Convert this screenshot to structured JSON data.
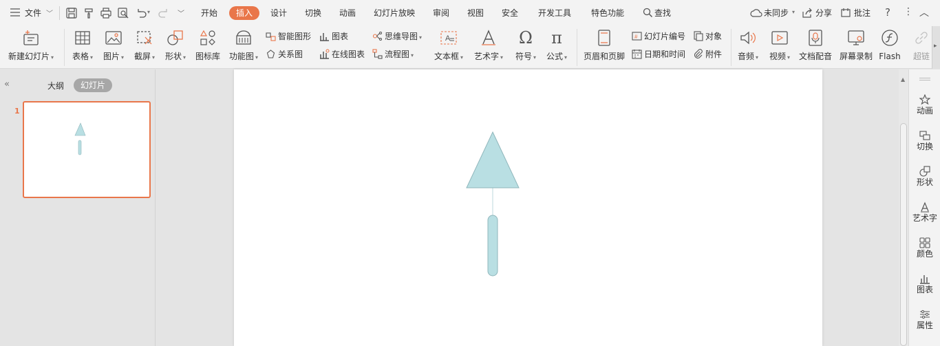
{
  "menu": {
    "file_label": "文件",
    "tabs": [
      "开始",
      "插入",
      "设计",
      "切换",
      "动画",
      "幻灯片放映",
      "审阅",
      "视图",
      "安全",
      "开发工具",
      "特色功能"
    ],
    "active_tab": "插入",
    "search_label": "查找",
    "sync_label": "未同步",
    "share_label": "分享",
    "comment_label": "批注"
  },
  "quick_access_icons": [
    "save-icon",
    "format-painter-icon",
    "print-icon",
    "print-preview-icon",
    "undo-icon",
    "redo-icon",
    "customize-icon"
  ],
  "ribbon": {
    "new_slide": "新建幻灯片",
    "table": "表格",
    "picture": "图片",
    "screenshot": "截屏",
    "shape": "形状",
    "icon_library": "图标库",
    "function_chart": "功能图",
    "smart_art": "智能图形",
    "chart": "图表",
    "relation_chart": "关系图",
    "online_chart": "在线图表",
    "mind_map": "思维导图",
    "flowchart": "流程图",
    "text_box": "文本框",
    "word_art": "艺术字",
    "symbol": "符号",
    "formula": "公式",
    "header_footer": "页眉和页脚",
    "slide_number": "幻灯片编号",
    "object": "对象",
    "date_time": "日期和时间",
    "attachment": "附件",
    "audio": "音频",
    "video": "视频",
    "doc_dubbing": "文档配音",
    "screen_record": "屏幕录制",
    "flash": "Flash",
    "hyperlink": "超链"
  },
  "left_panel": {
    "outline_tab": "大纲",
    "slides_tab": "幻灯片",
    "slide_number": "1"
  },
  "right_pane": [
    {
      "label": "动画",
      "icon": "animation-icon"
    },
    {
      "label": "切换",
      "icon": "transition-icon"
    },
    {
      "label": "形状",
      "icon": "shape-icon"
    },
    {
      "label": "艺术字",
      "icon": "word-art-icon"
    },
    {
      "label": "颜色",
      "icon": "color-icon"
    },
    {
      "label": "图表",
      "icon": "chart-icon"
    },
    {
      "label": "属性",
      "icon": "properties-icon"
    }
  ],
  "colors": {
    "accent": "#e9764a",
    "shape_fill": "#b9dfe3",
    "shape_stroke": "#8fb6bb"
  }
}
